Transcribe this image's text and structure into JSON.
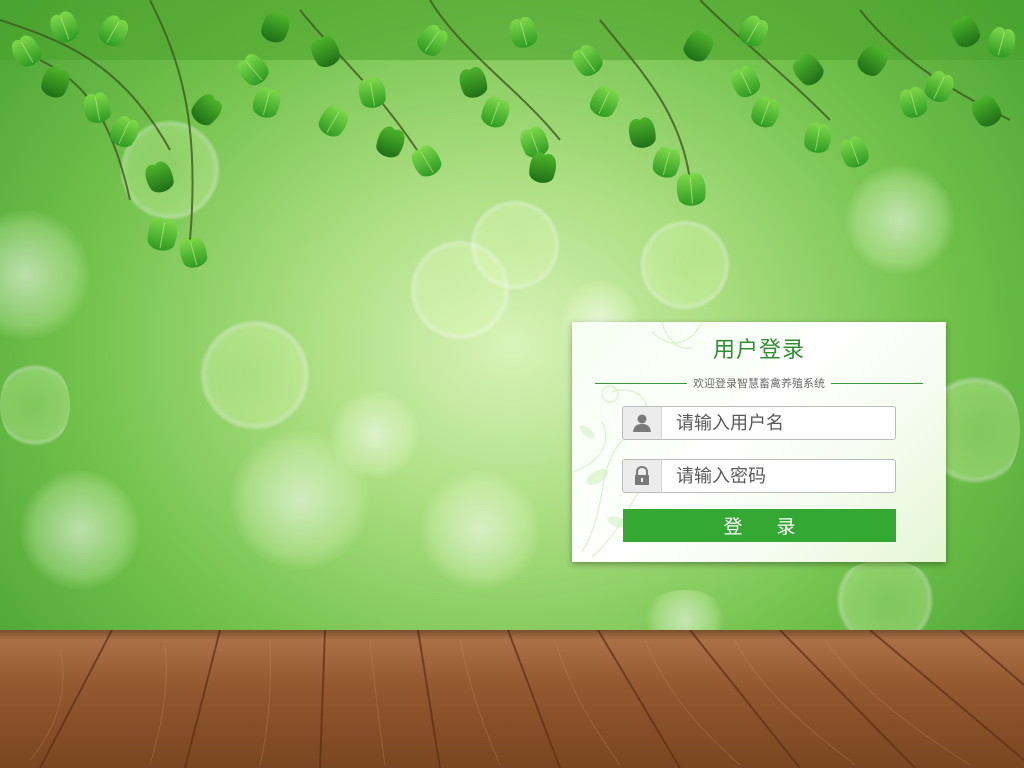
{
  "login": {
    "title": "用户登录",
    "subtitle": "欢迎登录智慧畜禽养殖系统",
    "username_placeholder": "请输入用户名",
    "password_placeholder": "请输入密码",
    "submit_label": "登 录"
  },
  "icons": {
    "username": "user-icon",
    "password": "lock-icon"
  },
  "colors": {
    "accent": "#34a832",
    "title": "#2f8f2f"
  }
}
